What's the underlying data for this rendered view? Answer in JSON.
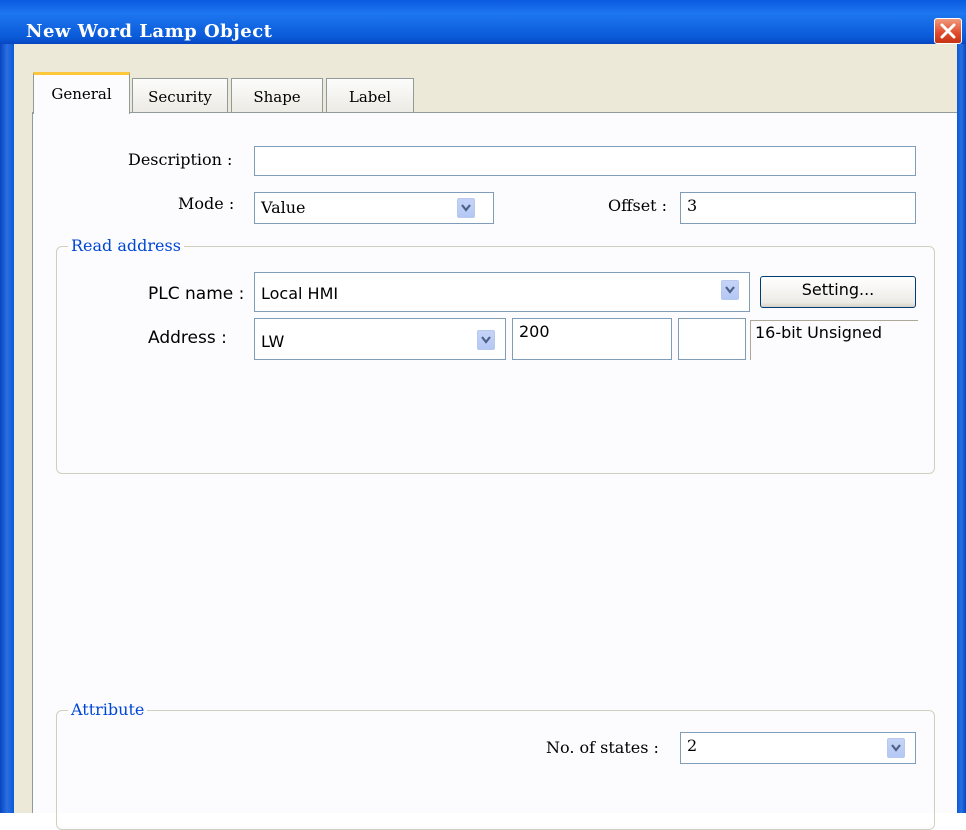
{
  "window": {
    "title": "New  Word Lamp Object"
  },
  "tabs": [
    {
      "label": "General",
      "active": true
    },
    {
      "label": "Security"
    },
    {
      "label": "Shape"
    },
    {
      "label": "Label"
    }
  ],
  "general": {
    "description_label": "Description :",
    "description_value": "",
    "mode_label": "Mode :",
    "mode_value": "Value",
    "offset_label": "Offset :",
    "offset_value": "3"
  },
  "read_address": {
    "group_title": "Read address",
    "plc_name_label": "PLC name :",
    "plc_name_value": "Local HMI",
    "setting_button": "Setting...",
    "address_label": "Address :",
    "address_device": "LW",
    "address_number": "200",
    "address_extra": "",
    "data_type": "16-bit Unsigned"
  },
  "attribute": {
    "group_title": "Attribute",
    "states_label": "No. of states :",
    "states_value": "2"
  },
  "icons": [
    "close-icon",
    "chevron-down-icon"
  ],
  "colors": {
    "title_bar": "#0a5ae0",
    "group_title": "#0046d5",
    "active_tab_accent": "#ffc83c",
    "close_button": "#e0482a"
  }
}
